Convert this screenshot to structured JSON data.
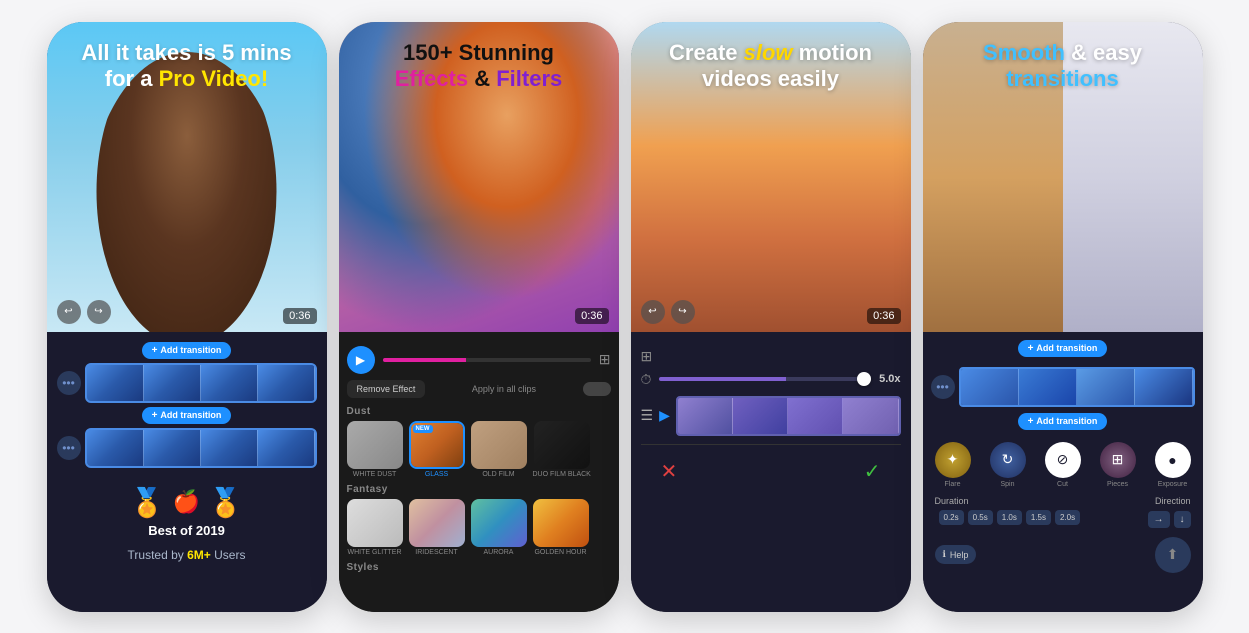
{
  "cards": [
    {
      "id": "card1",
      "headline_line1": "All it takes is 5 mins",
      "headline_line2_prefix": "for a ",
      "headline_line2_highlight": "Pro Video!",
      "timer": "0:36",
      "add_transition_label": "Add transition",
      "best_of": "Best of 2019",
      "trusted_prefix": "Trusted by ",
      "trusted_highlight": "6M+",
      "trusted_suffix": " Users"
    },
    {
      "id": "card2",
      "headline_line1": "150+ Stunning",
      "headline_effects": "Effects",
      "headline_and": " & ",
      "headline_filters": "Filters",
      "timer": "0:36",
      "remove_effect": "Remove Effect",
      "apply_all": "Apply in all clips",
      "section_dust": "Dust",
      "section_fantasy": "Fantasy",
      "section_styles": "Styles",
      "effects": [
        {
          "name": "WHITE DUST",
          "selected": false,
          "new": false
        },
        {
          "name": "GLASS",
          "selected": true,
          "new": true
        },
        {
          "name": "OLD FILM",
          "selected": false,
          "new": false
        },
        {
          "name": "DUO FILM BLACK",
          "selected": false,
          "new": false
        }
      ],
      "fantasy_effects": [
        {
          "name": "WHITE GLITTER",
          "selected": false
        },
        {
          "name": "IRIDESCENT",
          "selected": false
        },
        {
          "name": "AURORA",
          "selected": false
        },
        {
          "name": "GOLDEN HOUR",
          "selected": false
        }
      ]
    },
    {
      "id": "card3",
      "headline_prefix": "Create ",
      "headline_slow": "slow",
      "headline_suffix": " motion\nvideos easily",
      "timer": "0:36",
      "speed_value": "5.0x",
      "cancel_label": "✕",
      "confirm_label": "✓"
    },
    {
      "id": "card4",
      "headline_smooth": "Smooth",
      "headline_middle": " & easy",
      "headline_transitions": "transitions",
      "add_transition_label": "Add transition",
      "transitions": [
        {
          "name": "Flare"
        },
        {
          "name": "Spin"
        },
        {
          "name": "Cut",
          "active": true
        },
        {
          "name": "Pieces"
        },
        {
          "name": "Exposure"
        }
      ],
      "duration_label": "Duration",
      "direction_label": "Direction",
      "durations": [
        "0.2s",
        "0.5s",
        "1.0s",
        "1.5s",
        "2.0s"
      ],
      "directions": [
        "→",
        "↓"
      ],
      "help_label": "Help"
    }
  ]
}
